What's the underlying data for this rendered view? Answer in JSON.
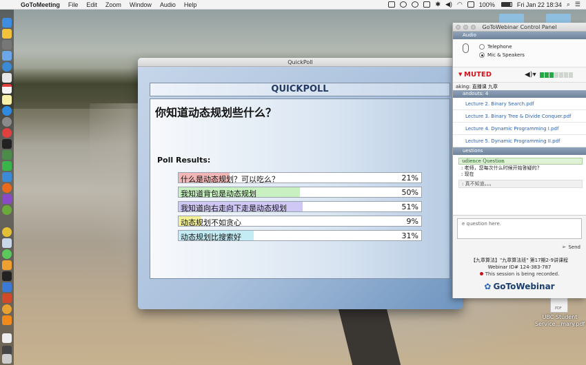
{
  "menubar": {
    "apple": "",
    "app": "GoToMeeting",
    "menus": [
      "File",
      "Edit",
      "Zoom",
      "Window",
      "Audio",
      "Help"
    ],
    "battery": "100%",
    "datetime": "Fri Jan 22  18:34"
  },
  "quickpoll": {
    "window_title": "QuickPoll",
    "header": "QUICKPOLL",
    "question": "你知道动态规划些什么？",
    "results_label": "Poll Results:",
    "results": [
      {
        "label": "什么是动态规划？可以吃么？",
        "percent": "21%",
        "value": 21,
        "color": "#f3b6b6"
      },
      {
        "label": "我知道背包是动态规划",
        "percent": "50%",
        "value": 50,
        "color": "#c8f0c0"
      },
      {
        "label": "我知道向右走向下走是动态规划",
        "percent": "51%",
        "value": 51,
        "color": "#cfc8f5"
      },
      {
        "label": "动态规划不如贪心",
        "percent": "9%",
        "value": 9,
        "color": "#f4f097"
      },
      {
        "label": "动态规划比搜索好",
        "percent": "31%",
        "value": 31,
        "color": "#c3ecf4"
      }
    ]
  },
  "control_panel": {
    "title": "GoToWebinar Control Panel",
    "audio_section": "Audio",
    "audio_options": [
      "Telephone",
      "Mic & Speakers"
    ],
    "muted": "MUTED",
    "speaking": "aking:  直播课 九章",
    "handouts_header": "andouts: 4",
    "handouts": [
      "Lecture 2. Binary Search.pdf",
      "Lecture 3. Binary Tree & Divide Conquer.pdf",
      "Lecture 4. Dynamic Programming I.pdf",
      "Lecture 5. Dynamic Programming II.pdf"
    ],
    "questions_header": "uestions",
    "question_head": "udience Question",
    "question_line1": ": 老师，您每次什么时候开始答疑的?",
    "question_line2": ": 现在",
    "answer_preview": ": 真不知道。。。",
    "input_placeholder": "e question here.",
    "send": "Send",
    "webinar_name": "【九章算法】\"九章算法班\" 第17期2-9讲课程",
    "webinar_id": "Webinar ID# 124-383-787",
    "recording": "This session is being recorded.",
    "logo": "GoToWebinar"
  },
  "desktop": {
    "pdf_label": "PDF",
    "pdf_caption": "UBC Student Service...mary.pdf"
  }
}
